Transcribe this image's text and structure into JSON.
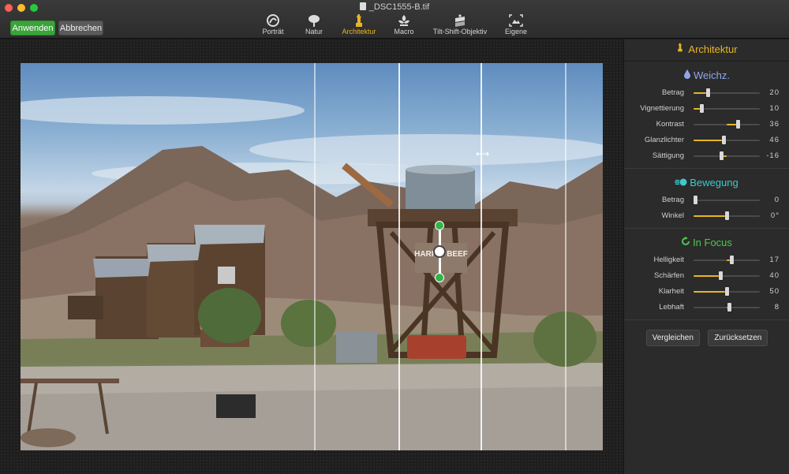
{
  "window": {
    "title": "_DSC1555-B.tif",
    "controls": {
      "close_color": "#fe5f57",
      "minimize_color": "#febc2e",
      "zoom_color": "#28c840"
    }
  },
  "toolbar": {
    "apply_label": "Anwenden",
    "cancel_label": "Abbrechen",
    "modes": [
      {
        "label": "Porträt",
        "icon": "portrait-icon"
      },
      {
        "label": "Natur",
        "icon": "tree-icon"
      },
      {
        "label": "Architektur",
        "icon": "statue-icon",
        "active": true
      },
      {
        "label": "Macro",
        "icon": "flower-icon"
      },
      {
        "label": "Tilt-Shift-Objektiv",
        "icon": "tilt-shift-icon"
      },
      {
        "label": "Eigene",
        "icon": "custom-frame-icon"
      }
    ]
  },
  "sidebar": {
    "header": "Architektur",
    "sections": [
      {
        "title": "Weichz.",
        "title_color": "#8fa8e8",
        "icon": "droplet-icon",
        "rows": [
          {
            "label": "Betrag",
            "value": "20",
            "level": 0.2
          },
          {
            "label": "Vignettierung",
            "value": "10",
            "level": 0.1
          },
          {
            "label": "Kontrast",
            "value": "36",
            "level": 0.68
          },
          {
            "label": "Glanzlichter",
            "value": "46",
            "level": 0.46
          },
          {
            "label": "Sättigung",
            "value": "-16",
            "level": 0.42
          }
        ]
      },
      {
        "title": "Bewegung",
        "title_color": "#3fc9c9",
        "icon": "motion-icon",
        "rows": [
          {
            "label": "Betrag",
            "value": "0",
            "level": 0.0
          },
          {
            "label": "Winkel",
            "value": "0°",
            "level": 0.5
          }
        ]
      },
      {
        "title": "In Focus",
        "title_color": "#4cc94c",
        "icon": "refresh-icon",
        "rows": [
          {
            "label": "Helligkeit",
            "value": "17",
            "level": 0.58
          },
          {
            "label": "Schärfen",
            "value": "40",
            "level": 0.4
          },
          {
            "label": "Klarheit",
            "value": "50",
            "level": 0.5
          },
          {
            "label": "Lebhaft",
            "value": "8",
            "level": 0.54
          }
        ]
      }
    ],
    "compare_label": "Vergleichen",
    "reset_label": "Zurücksetzen"
  },
  "accent_color": "#e7b524",
  "photo": {
    "sign_text": "HARRIS BEEF"
  }
}
